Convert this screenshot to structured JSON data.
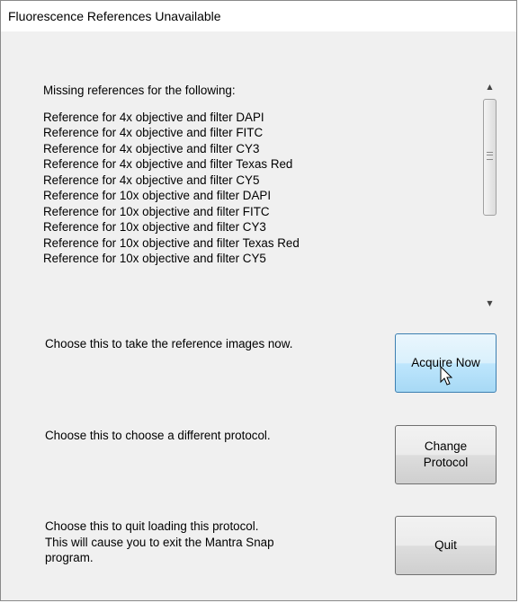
{
  "window": {
    "title": "Fluorescence References Unavailable"
  },
  "references_list": {
    "heading": "Missing references for the following:",
    "items": [
      "Reference for 4x objective and filter DAPI",
      "Reference for 4x objective and filter FITC",
      "Reference for 4x objective and filter CY3",
      "Reference for 4x objective and filter Texas Red",
      "Reference for 4x objective and filter CY5",
      "Reference for 10x objective and filter DAPI",
      "Reference for 10x objective and filter FITC",
      "Reference for 10x objective and filter CY3",
      "Reference for 10x objective and filter Texas Red",
      "Reference for 10x objective and filter CY5"
    ],
    "scrollbar": {
      "up_arrow_icon": "scroll-up-arrow",
      "down_arrow_icon": "scroll-down-arrow"
    }
  },
  "options": {
    "acquire": {
      "description": "Choose this to take the reference images now.",
      "button_label": "Acquire Now"
    },
    "change": {
      "description": "Choose this to choose a different protocol.",
      "button_label": "Change\nProtocol"
    },
    "quit": {
      "description": "Choose this to quit loading this protocol.\nThis will cause you to exit the Mantra Snap\nprogram.",
      "button_label": "Quit"
    }
  },
  "colors": {
    "hot_button_border": "#3c7fb1",
    "hot_button_fill": "#bee6fd",
    "dialog_background": "#f0f0f0"
  }
}
